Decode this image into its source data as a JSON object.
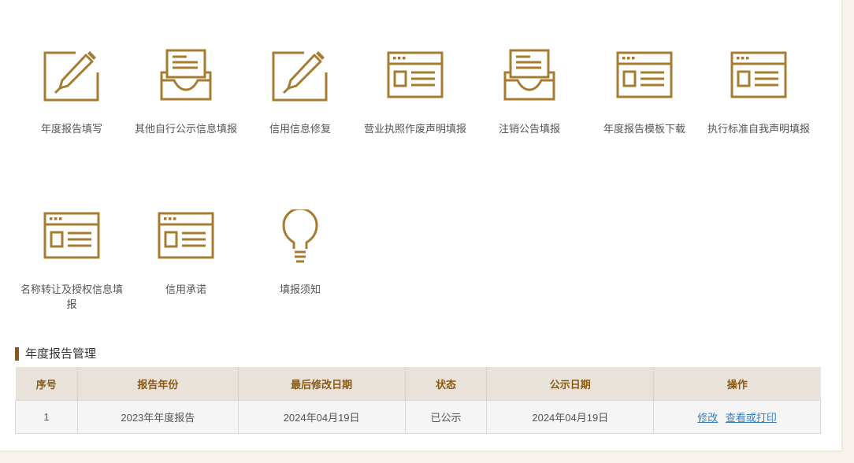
{
  "colors": {
    "icon": "#a57c32",
    "accent": "#8a5a13",
    "link": "#3a7fc1"
  },
  "tiles": [
    {
      "label": "年度报告填写",
      "icon": "edit-icon"
    },
    {
      "label": "其他自行公示信息填报",
      "icon": "inbox-icon"
    },
    {
      "label": "信用信息修复",
      "icon": "edit-icon"
    },
    {
      "label": "营业执照作废声明填报",
      "icon": "browser-window-icon"
    },
    {
      "label": "注销公告填报",
      "icon": "inbox-icon"
    },
    {
      "label": "年度报告模板下载",
      "icon": "browser-window-icon"
    },
    {
      "label": "执行标准自我声明填报",
      "icon": "browser-window-icon"
    },
    {
      "label": "名称转让及授权信息填报",
      "icon": "browser-window-icon"
    },
    {
      "label": "信用承诺",
      "icon": "browser-window-icon"
    },
    {
      "label": "填报须知",
      "icon": "lightbulb-icon"
    }
  ],
  "section": {
    "title": "年度报告管理"
  },
  "table": {
    "headers": [
      "序号",
      "报告年份",
      "最后修改日期",
      "状态",
      "公示日期",
      "操作"
    ],
    "rows": [
      {
        "index": "1",
        "year": "2023年年度报告",
        "modified": "2024年04月19日",
        "status": "已公示",
        "published": "2024年04月19日",
        "actions": [
          "修改",
          "查看或打印"
        ]
      }
    ]
  }
}
